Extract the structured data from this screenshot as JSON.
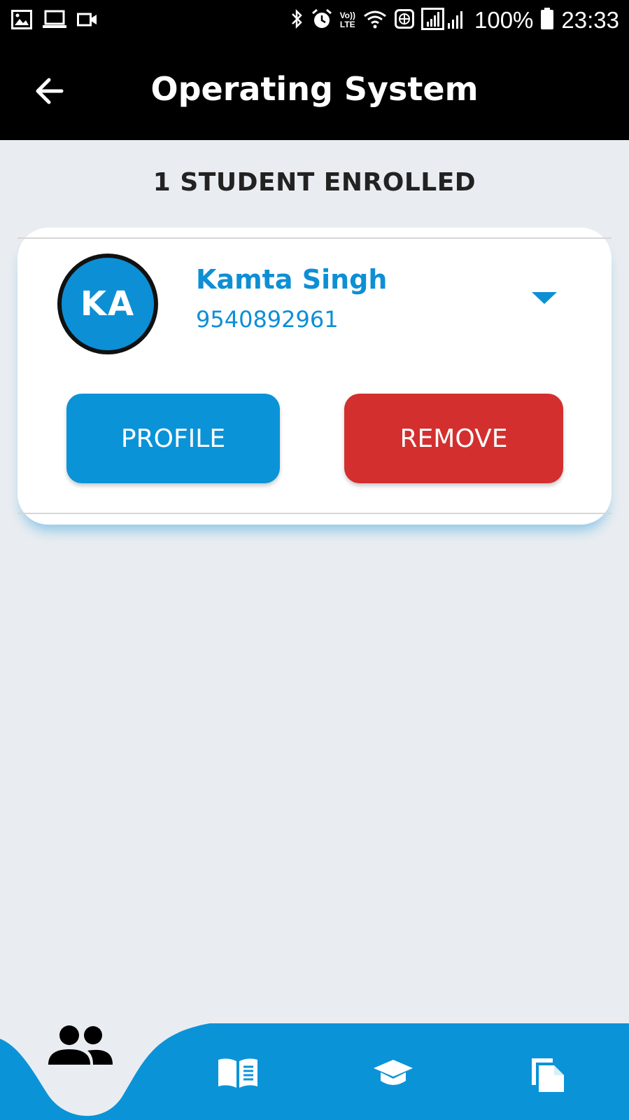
{
  "status_bar": {
    "battery": "100%",
    "time": "23:33",
    "volte_top": "Vo))",
    "volte_bottom": "LTE",
    "icons": [
      "image-icon",
      "laptop-icon",
      "video-icon",
      "bluetooth-icon",
      "alarm-icon",
      "wifi-icon",
      "vpn-icon",
      "signal-icon",
      "battery-icon"
    ]
  },
  "app_bar": {
    "title": "Operating System",
    "back_icon": "arrow-left-icon"
  },
  "enrollment": {
    "heading": "1 STUDENT ENROLLED"
  },
  "students": [
    {
      "initials": "KA",
      "name": "Kamta Singh",
      "phone": "9540892961",
      "profile_label": "PROFILE",
      "remove_label": "REMOVE"
    }
  ],
  "bottom_nav": {
    "items": [
      {
        "icon": "people-icon",
        "active": true
      },
      {
        "icon": "book-icon",
        "active": false
      },
      {
        "icon": "graduation-cap-icon",
        "active": false
      },
      {
        "icon": "documents-icon",
        "active": false
      }
    ]
  },
  "colors": {
    "accent": "#0d8fd5",
    "danger": "#d32f2f",
    "background": "#e9edf1",
    "bar": "#000000"
  }
}
